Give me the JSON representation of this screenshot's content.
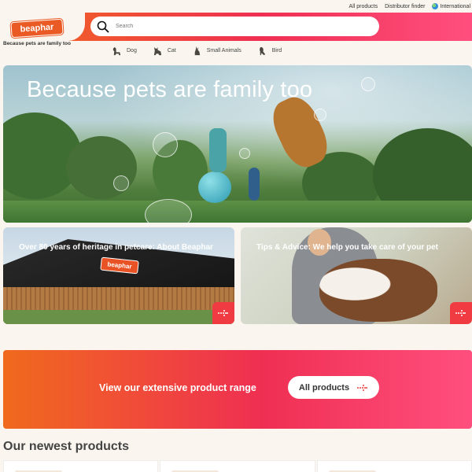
{
  "utility": {
    "all_products": "All products",
    "distributor": "Distributor finder",
    "international": "International"
  },
  "header": {
    "logo_text": "beaphar",
    "tagline": "Because pets are family too",
    "search_placeholder": "Search"
  },
  "categories": [
    {
      "label": "Dog",
      "icon": "dog-icon"
    },
    {
      "label": "Cat",
      "icon": "cat-icon"
    },
    {
      "label": "Small Animals",
      "icon": "rabbit-icon"
    },
    {
      "label": "Bird",
      "icon": "bird-icon"
    }
  ],
  "hero": {
    "headline": "Because pets are family too"
  },
  "cards": [
    {
      "title": "Over 80 years of heritage in petcare: About Beaphar",
      "sign_text": "beaphar"
    },
    {
      "title": "Tips & Advice: We help you take care of your pet"
    }
  ],
  "promo": {
    "text": "View our extensive product range",
    "button": "All products"
  },
  "newest": {
    "heading": "Our newest products"
  },
  "colors": {
    "brand_orange": "#f06a1d",
    "brand_red": "#ef2f52",
    "brand_pink": "#ff4f7e",
    "background": "#faf6ef"
  }
}
